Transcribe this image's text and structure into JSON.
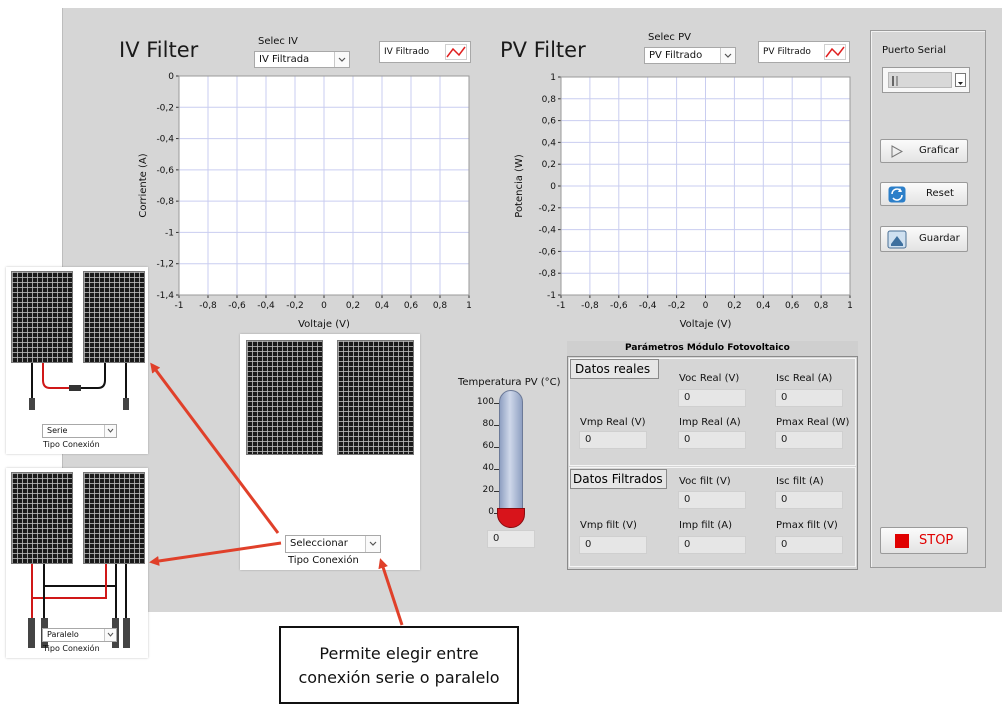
{
  "iv_panel": {
    "title": "IV Filter",
    "selector_label": "Selec IV",
    "selector_value": "IV Filtrada",
    "legend_label": "IV Filtrado",
    "chart_data": {
      "type": "line",
      "title": "",
      "xlabel": "Voltaje (V)",
      "ylabel": "Corriente (A)",
      "xlim": [
        -1,
        1
      ],
      "ylim": [
        -1.4,
        0
      ],
      "x_ticks": [
        "-1",
        "-0,8",
        "-0,6",
        "-0,4",
        "-0,2",
        "0",
        "0,2",
        "0,4",
        "0,6",
        "0,8",
        "1"
      ],
      "y_ticks": [
        "0",
        "-0,2",
        "-0,4",
        "-0,6",
        "-0,8",
        "-1",
        "-1,2",
        "-1,4"
      ],
      "grid": true,
      "series": [
        {
          "name": "IV Filtrado",
          "values": []
        }
      ]
    }
  },
  "pv_panel": {
    "title": "PV Filter",
    "selector_label": "Selec PV",
    "selector_value": "PV Filtrado",
    "legend_label": "PV Filtrado",
    "chart_data": {
      "type": "line",
      "title": "",
      "xlabel": "Voltaje (V)",
      "ylabel": "Potencia (W)",
      "xlim": [
        -1,
        1
      ],
      "ylim": [
        -1,
        1
      ],
      "x_ticks": [
        "-1",
        "-0,8",
        "-0,6",
        "-0,4",
        "-0,2",
        "0",
        "0,2",
        "0,4",
        "0,6",
        "0,8",
        "1"
      ],
      "y_ticks": [
        "1",
        "0,8",
        "0,6",
        "0,4",
        "0,2",
        "0",
        "-0,2",
        "-0,4",
        "-0,6",
        "-0,8",
        "-1"
      ],
      "grid": true,
      "series": [
        {
          "name": "PV Filtrado",
          "values": []
        }
      ]
    }
  },
  "serial": {
    "label": "Puerto Serial",
    "value": ""
  },
  "buttons": {
    "graficar": "Graficar",
    "reset": "Reset",
    "guardar": "Guardar",
    "stop": "STOP"
  },
  "temperature": {
    "label": "Temperatura PV (°C)",
    "ticks": [
      "100",
      "80",
      "60",
      "40",
      "20",
      "0"
    ],
    "value": "0",
    "level": 0
  },
  "params": {
    "title": "Parámetros Módulo Fotovoltaico",
    "reales_label": "Datos reales",
    "filtrados_label": "Datos Filtrados",
    "voc_real": {
      "label": "Voc Real (V)",
      "value": "0"
    },
    "isc_real": {
      "label": "Isc Real (A)",
      "value": "0"
    },
    "vmp_real": {
      "label": "Vmp Real (V)",
      "value": "0"
    },
    "imp_real": {
      "label": "Imp Real (A)",
      "value": "0"
    },
    "pmax_real": {
      "label": "Pmax Real (W)",
      "value": "0"
    },
    "voc_filt": {
      "label": "Voc filt (V)",
      "value": "0"
    },
    "isc_filt": {
      "label": "Isc filt (A)",
      "value": "0"
    },
    "vmp_filt": {
      "label": "Vmp filt (V)",
      "value": "0"
    },
    "imp_filt": {
      "label": "Imp filt (A)",
      "value": "0"
    },
    "pmax_filt": {
      "label": "Pmax filt (V)",
      "value": "0"
    }
  },
  "connection": {
    "selector_value": "Seleccionar",
    "label": "Tipo Conexión",
    "serie_value": "Serie",
    "paralelo_value": "Paralelo"
  },
  "callout": {
    "line1": "Permite elegir entre",
    "line2": "conexión serie o paralelo"
  },
  "colors": {
    "panel_bg": "#d6d6d6",
    "plot_bg": "#ffffff",
    "grid": "#c9cdf0",
    "arrow": "#e0402a",
    "stop": "#e00000",
    "legend_line": "#e02020"
  }
}
